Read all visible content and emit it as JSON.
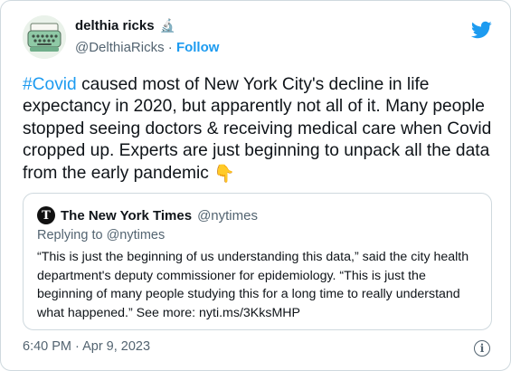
{
  "author": {
    "display_name": "delthia ricks",
    "name_emoji": "🔬",
    "handle": "@DelthiaRicks",
    "separator": "·",
    "follow_label": "Follow",
    "avatar_icon": "typewriter-avatar"
  },
  "tweet": {
    "hashtag": "#Covid",
    "text": " caused most of New York City's decline in life expectancy in 2020, but apparently not all of it. Many people stopped seeing doctors & receiving medical care when Covid cropped up. Experts are just beginning to unpack all the data from the early pandemic ",
    "emoji": "👇"
  },
  "quoted": {
    "display_name": "The New York Times",
    "handle": "@nytimes",
    "logo_letter": "T",
    "replying_to": "Replying to @nytimes",
    "text": "“This is just the beginning of us understanding this data,” said the city health department's deputy commissioner for epidemiology. “This is just the beginning of many people studying this for a long time to really understand what happened.” See more: nyti.ms/3KksMHP"
  },
  "meta": {
    "timestamp": "6:40 PM · Apr 9, 2023",
    "info_icon": "info-icon"
  },
  "colors": {
    "accent": "#1d9bf0",
    "text": "#0f1419",
    "secondary": "#536471",
    "border": "#cfd9de"
  }
}
